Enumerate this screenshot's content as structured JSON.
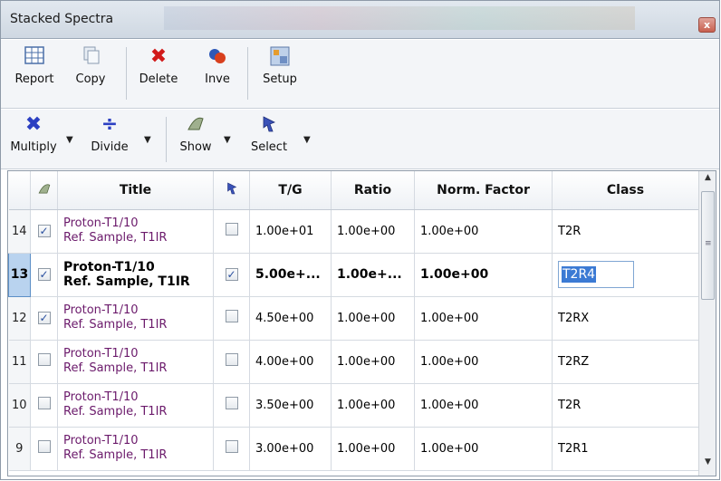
{
  "window": {
    "title": "Stacked Spectra",
    "close_glyph": "x"
  },
  "toolbar1": {
    "report_label": "Report",
    "copy_label": "Copy",
    "delete_label": "Delete",
    "inve_label": "Inve",
    "setup_label": "Setup"
  },
  "toolbar2": {
    "multiply_label": "Multiply",
    "divide_label": "Divide",
    "show_label": "Show",
    "select_label": "Select"
  },
  "grid": {
    "columns": [
      "",
      "",
      "Title",
      "",
      "T/G",
      "Ratio",
      "Norm. Factor",
      "Class"
    ],
    "rows": [
      {
        "num": "14",
        "show": true,
        "title1": "Proton-T1/10",
        "title2": "Ref. Sample, T1IR",
        "pinned": false,
        "tg": "1.00e+01",
        "ratio": "1.00e+00",
        "norm": "1.00e+00",
        "class": "T2R"
      },
      {
        "num": "13",
        "show": true,
        "title1": "Proton-T1/10",
        "title2": "Ref. Sample, T1IR",
        "pinned": true,
        "tg": "5.00e+...",
        "ratio": "1.00e+...",
        "norm": "1.00e+00",
        "class": "T2R4"
      },
      {
        "num": "12",
        "show": true,
        "title1": "Proton-T1/10",
        "title2": "Ref. Sample, T1IR",
        "pinned": false,
        "tg": "4.50e+00",
        "ratio": "1.00e+00",
        "norm": "1.00e+00",
        "class": "T2RX"
      },
      {
        "num": "11",
        "show": false,
        "title1": "Proton-T1/10",
        "title2": "Ref. Sample, T1IR",
        "pinned": false,
        "tg": "4.00e+00",
        "ratio": "1.00e+00",
        "norm": "1.00e+00",
        "class": "T2RZ"
      },
      {
        "num": "10",
        "show": false,
        "title1": "Proton-T1/10",
        "title2": "Ref. Sample, T1IR",
        "pinned": false,
        "tg": "3.50e+00",
        "ratio": "1.00e+00",
        "norm": "1.00e+00",
        "class": "T2R"
      },
      {
        "num": "9",
        "show": false,
        "title1": "Proton-T1/10",
        "title2": "Ref. Sample, T1IR",
        "pinned": false,
        "tg": "3.00e+00",
        "ratio": "1.00e+00",
        "norm": "1.00e+00",
        "class": "T2R1"
      }
    ]
  },
  "colors": {
    "title_text": "#6b1a6b",
    "selection_highlight": "#3b7ad4",
    "delete_icon": "#d11a1a",
    "multiply_icon": "#2b3fc2"
  }
}
